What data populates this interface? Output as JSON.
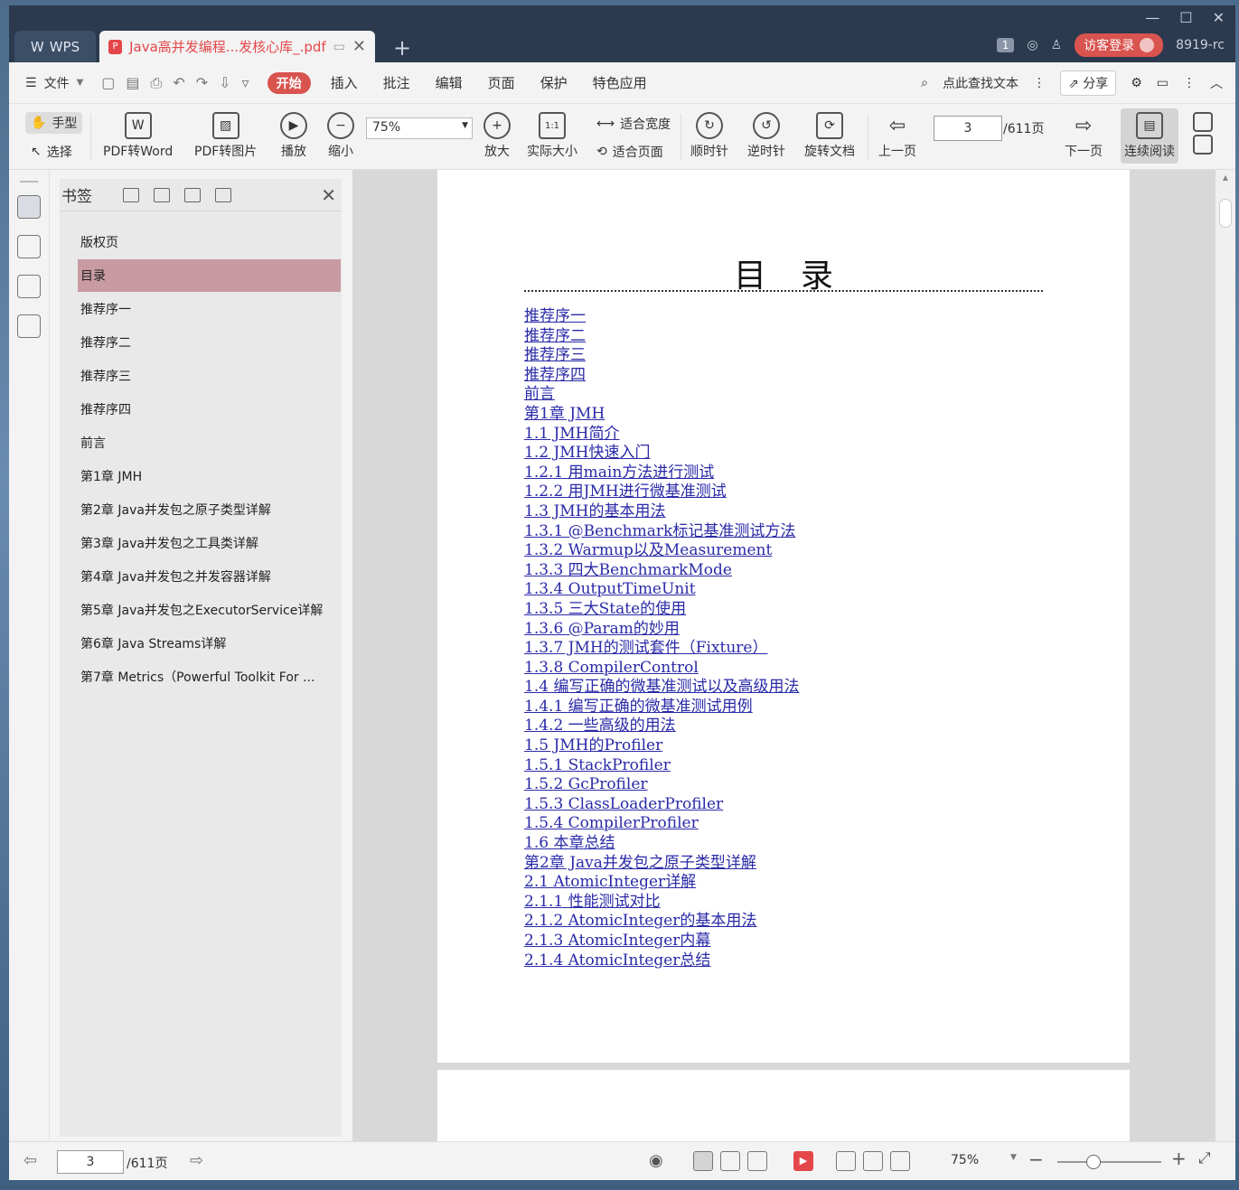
{
  "window": {
    "app_tab": "WPS",
    "doc_tab": "Java高并发编程...发核心库_.pdf",
    "badge": "1",
    "login": "访客登录",
    "user": "8919-rc"
  },
  "menu": {
    "file": "文件",
    "items": [
      "开始",
      "插入",
      "批注",
      "编辑",
      "页面",
      "保护",
      "特色应用"
    ],
    "search": "点此查找文本",
    "share": "分享"
  },
  "toolbar": {
    "hand": "手型",
    "select": "选择",
    "pdf_word": "PDF转Word",
    "pdf_img": "PDF转图片",
    "play": "播放",
    "zoom_out": "缩小",
    "zoom_value": "75%",
    "zoom_in": "放大",
    "actual": "实际大小",
    "fit_width": "适合宽度",
    "fit_page": "适合页面",
    "cw": "顺时针",
    "ccw": "逆时针",
    "rotate": "旋转文档",
    "prev": "上一页",
    "page": "3",
    "total": "/611页",
    "next": "下一页",
    "continuous": "连续阅读"
  },
  "bookmarks": {
    "title": "书签",
    "items": [
      {
        "label": "版权页",
        "expandable": false
      },
      {
        "label": "目录",
        "expandable": false,
        "selected": true
      },
      {
        "label": "推荐序一",
        "expandable": false
      },
      {
        "label": "推荐序二",
        "expandable": false
      },
      {
        "label": "推荐序三",
        "expandable": false
      },
      {
        "label": "推荐序四",
        "expandable": false
      },
      {
        "label": "前言",
        "expandable": false
      },
      {
        "label": "第1章 JMH",
        "expandable": true
      },
      {
        "label": "第2章 Java并发包之原子类型详解",
        "expandable": true
      },
      {
        "label": "第3章 Java并发包之工具类详解",
        "expandable": true
      },
      {
        "label": "第4章 Java并发包之并发容器详解",
        "expandable": true
      },
      {
        "label": "第5章 Java并发包之ExecutorService详解",
        "expandable": true
      },
      {
        "label": "第6章 Java Streams详解",
        "expandable": true
      },
      {
        "label": "第7章 Metrics（Powerful Toolkit For ...",
        "expandable": true
      }
    ]
  },
  "doc": {
    "title": "目录",
    "toc": [
      "推荐序一",
      "推荐序二",
      "推荐序三",
      "推荐序四",
      "前言",
      "第1章 JMH",
      "1.1 JMH简介",
      "1.2 JMH快速入门",
      "1.2.1 用main方法进行测试",
      "1.2.2 用JMH进行微基准测试",
      "1.3 JMH的基本用法",
      "1.3.1 @Benchmark标记基准测试方法",
      "1.3.2 Warmup以及Measurement",
      "1.3.3 四大BenchmarkMode",
      "1.3.4 OutputTimeUnit",
      "1.3.5 三大State的使用",
      "1.3.6 @Param的妙用",
      "1.3.7 JMH的测试套件（Fixture）",
      "1.3.8 CompilerControl",
      "1.4 编写正确的微基准测试以及高级用法",
      "1.4.1 编写正确的微基准测试用例",
      "1.4.2 一些高级的用法",
      "1.5 JMH的Profiler",
      "1.5.1 StackProfiler",
      "1.5.2 GcProfiler",
      "1.5.3 ClassLoaderProfiler",
      "1.5.4 CompilerProfiler",
      "1.6 本章总结",
      "第2章 Java并发包之原子类型详解",
      "2.1 AtomicInteger详解",
      "2.1.1 性能测试对比",
      "2.1.2 AtomicInteger的基本用法",
      "2.1.3 AtomicInteger内幕",
      "2.1.4 AtomicInteger总结"
    ]
  },
  "status": {
    "page": "3",
    "total": "/611页",
    "zoom": "75%"
  }
}
